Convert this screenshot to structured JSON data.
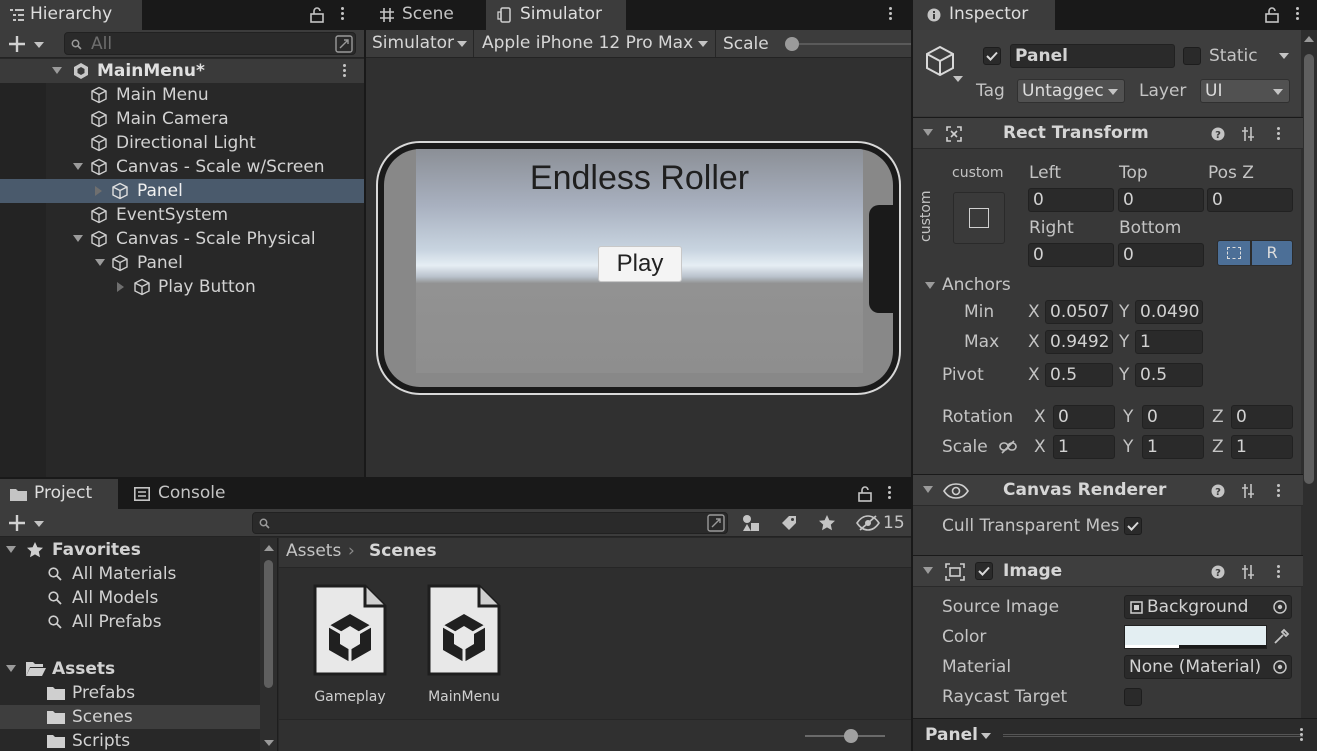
{
  "hierarchy": {
    "tab_label": "Hierarchy",
    "search_placeholder": "All",
    "scene_name": "MainMenu*",
    "items": [
      {
        "label": "Main Menu"
      },
      {
        "label": "Main Camera"
      },
      {
        "label": "Directional Light"
      },
      {
        "label": "Canvas - Scale w/Screen"
      },
      {
        "label": "Panel"
      },
      {
        "label": "EventSystem"
      },
      {
        "label": "Canvas - Scale Physical"
      },
      {
        "label": "Panel"
      },
      {
        "label": "Play Button"
      }
    ]
  },
  "center": {
    "tab_scene": "Scene",
    "tab_simulator": "Simulator",
    "mode_dropdown": "Simulator",
    "device_dropdown": "Apple iPhone 12 Pro Max",
    "scale_label": "Scale",
    "game_title": "Endless Roller",
    "play_button": "Play"
  },
  "inspector": {
    "tab_label": "Inspector",
    "object_name": "Panel",
    "static_label": "Static",
    "tag_label": "Tag",
    "tag_value": "Untaggec",
    "layer_label": "Layer",
    "layer_value": "UI",
    "rect_transform": {
      "title": "Rect Transform",
      "custom_h": "custom",
      "custom_v": "custom",
      "left_label": "Left",
      "left": "0",
      "top_label": "Top",
      "top": "0",
      "posz_label": "Pos Z",
      "posz": "0",
      "right_label": "Right",
      "right": "0",
      "bottom_label": "Bottom",
      "bottom": "0",
      "r_button": "R",
      "anchors_label": "Anchors",
      "min_label": "Min",
      "min_x": "0.0507",
      "min_y": "0.0490",
      "max_label": "Max",
      "max_x": "0.9492",
      "max_y": "1",
      "pivot_label": "Pivot",
      "pivot_x": "0.5",
      "pivot_y": "0.5",
      "rotation_label": "Rotation",
      "rot_x": "0",
      "rot_y": "0",
      "rot_z": "0",
      "scale_label": "Scale",
      "scale_x": "1",
      "scale_y": "1",
      "scale_z": "1",
      "x": "X",
      "y": "Y",
      "z": "Z"
    },
    "canvas_renderer": {
      "title": "Canvas Renderer",
      "cull_label": "Cull Transparent Mes"
    },
    "image": {
      "title": "Image",
      "source_label": "Source Image",
      "source_value": "Background",
      "color_label": "Color",
      "material_label": "Material",
      "material_value": "None (Material)",
      "raycast_label": "Raycast Target"
    },
    "footer_label": "Panel"
  },
  "project": {
    "tab_project": "Project",
    "tab_console": "Console",
    "hidden_count": "15",
    "favorites_label": "Favorites",
    "favorites": [
      {
        "label": "All Materials"
      },
      {
        "label": "All Models"
      },
      {
        "label": "All Prefabs"
      }
    ],
    "assets_label": "Assets",
    "folders": [
      {
        "label": "Prefabs"
      },
      {
        "label": "Scenes"
      },
      {
        "label": "Scripts"
      }
    ],
    "breadcrumb_root": "Assets",
    "breadcrumb_current": "Scenes",
    "files": [
      {
        "label": "Gameplay"
      },
      {
        "label": "MainMenu"
      }
    ]
  },
  "colors": {
    "selection": "#2d5075",
    "panel_bg": "#282828",
    "toolbar_bg": "#3c3c3c",
    "accent_blue": "#4c6f97"
  }
}
